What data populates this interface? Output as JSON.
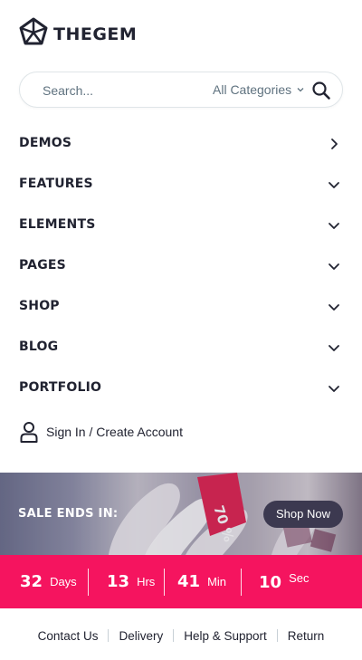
{
  "brand": {
    "name": "THEGEM",
    "logo_icon": "gem-pentagon-icon"
  },
  "search": {
    "placeholder": "Search...",
    "category": "All Categories",
    "icon": "search-icon"
  },
  "menu": {
    "items": [
      {
        "label": "DEMOS",
        "toggle": "chevron-right-icon"
      },
      {
        "label": "FEATURES",
        "toggle": "chevron-down-icon"
      },
      {
        "label": "ELEMENTS",
        "toggle": "chevron-down-icon"
      },
      {
        "label": "PAGES",
        "toggle": "chevron-down-icon"
      },
      {
        "label": "SHOP",
        "toggle": "chevron-down-icon"
      },
      {
        "label": "BLOG",
        "toggle": "chevron-down-icon"
      },
      {
        "label": "PORTFOLIO",
        "toggle": "chevron-down-icon"
      }
    ]
  },
  "account": {
    "label": "Sign In / Create Account",
    "icon": "user-icon"
  },
  "sale": {
    "title": "SALE ENDS IN:",
    "button": "Shop Now",
    "tag_text": "70 %"
  },
  "countdown": {
    "days": {
      "value": "32",
      "unit": "Days"
    },
    "hours": {
      "value": "13",
      "unit": "Hrs"
    },
    "minutes": {
      "value": "41",
      "unit": "Min"
    },
    "seconds": {
      "value": "10",
      "unit": "Sec"
    }
  },
  "footer": {
    "links": [
      "Contact Us",
      "Delivery",
      "Help & Support",
      "Return"
    ]
  },
  "colors": {
    "text": "#212331",
    "muted": "#5f727f",
    "accent": "#f5145f",
    "button_dark": "#3c3950",
    "border": "#dfe5e8"
  }
}
